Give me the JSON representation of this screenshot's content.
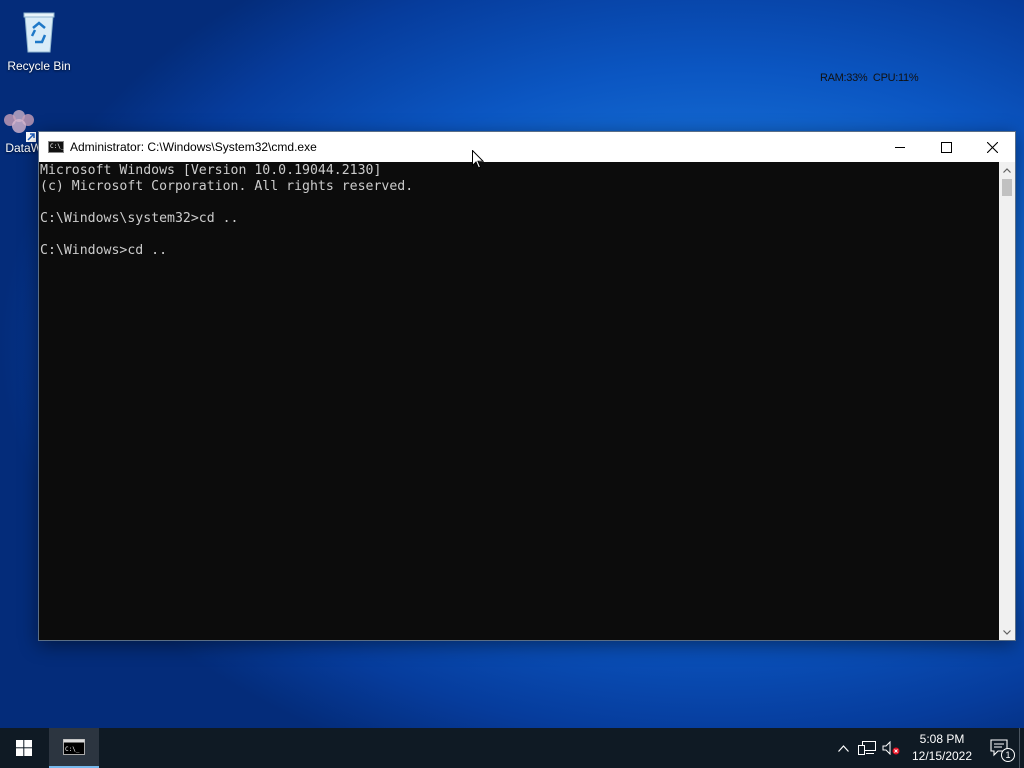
{
  "desktop": {
    "icons": [
      {
        "label": "Recycle Bin",
        "icon": "recycle-bin-icon"
      },
      {
        "label": "DataW",
        "icon": "datawrapper-shortcut-icon"
      }
    ],
    "sysmon": "RAM:33%  CPU:11%"
  },
  "window": {
    "title": "Administrator: C:\\Windows\\System32\\cmd.exe",
    "icon": "cmd-icon",
    "buttons": {
      "minimize": "minimize-icon",
      "maximize": "maximize-icon",
      "close": "close-icon"
    },
    "console_lines": [
      "Microsoft Windows [Version 10.0.19044.2130]",
      "(c) Microsoft Corporation. All rights reserved.",
      "",
      "C:\\Windows\\system32>cd ..",
      "",
      "C:\\Windows>cd .."
    ],
    "colors": {
      "console_bg": "#0c0c0c",
      "console_text": "#cccccc"
    }
  },
  "taskbar": {
    "start_icon": "windows-logo-icon",
    "items": [
      {
        "name": "Command Prompt",
        "icon": "cmd-icon",
        "active": true
      }
    ],
    "tray": {
      "icons": [
        "chevron-up-icon",
        "network-icon",
        "volume-muted-icon"
      ],
      "time": "5:08 PM",
      "date": "12/15/2022",
      "notification_count": "1"
    }
  }
}
